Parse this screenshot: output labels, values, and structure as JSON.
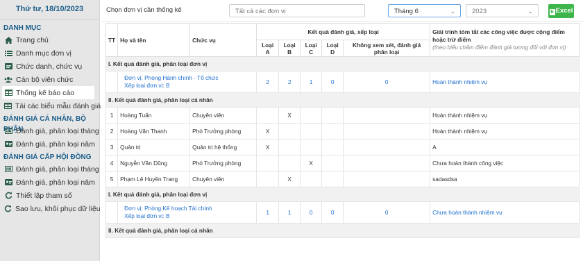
{
  "sidebar": {
    "date": "Thứ tư, 18/10/2023",
    "sections": [
      {
        "title": "DANH MỤC",
        "items": [
          {
            "label": "Trang chủ",
            "icon": "home-icon"
          },
          {
            "label": "Danh mục đơn vị",
            "icon": "list-icon"
          },
          {
            "label": "Chức danh, chức vụ",
            "icon": "card-icon"
          },
          {
            "label": "Cán bộ viên chức",
            "icon": "users-icon"
          },
          {
            "label": "Thống kê báo cáo",
            "icon": "table-icon",
            "active": true
          },
          {
            "label": "Tải các biểu mẫu đánh giá",
            "icon": "table-icon"
          }
        ]
      },
      {
        "title": "ĐÁNH GIÁ CÁ NHÂN, BỘ PHẬN",
        "items": [
          {
            "label": "Đánh giá, phân loại tháng",
            "icon": "form-icon"
          },
          {
            "label": "Đánh giá, phân loại năm",
            "icon": "id-card-icon"
          }
        ]
      },
      {
        "title": "ĐÁNH GIÁ CẤP HỘI ĐỒNG",
        "items": [
          {
            "label": "Đánh giá, phân loại tháng",
            "icon": "form-icon"
          },
          {
            "label": "Đánh giá, phân loại năm",
            "icon": "id-card-icon"
          },
          {
            "label": "Thiết lập tham số",
            "icon": "refresh-icon"
          },
          {
            "label": "Sao lưu, khôi phục dữ liệu",
            "icon": "refresh-icon"
          }
        ]
      }
    ]
  },
  "toolbar": {
    "label": "Chọn đơn vị cần thống kê",
    "unit_value": "Tất cả các đơn vị",
    "month_value": "Tháng 6",
    "year_value": "2023",
    "excel_label": "Excel"
  },
  "table": {
    "headers": {
      "tt": "TT",
      "name": "Họ và tên",
      "position": "Chức vụ",
      "result_group": "Kết quả đánh giá, xếp loại",
      "loai_a": "Loại A",
      "loai_b": "Loại B",
      "loai_c": "Loại C",
      "loai_d": "Loại D",
      "khong_xem_xet": "Không xem xét, đánh giá phân loại",
      "explanation": "Giải trình tóm tắt các công việc được cộng điểm hoặc trừ điểm",
      "explanation_note": "(theo biểu chấm điểm đánh giá tương đối với đơn vị)"
    },
    "sec_unit": "I. Kết quả đánh giá, phân loại đơn vị",
    "sec_person": "II. Kết quả đánh giá, phân loại cá nhân",
    "units": [
      {
        "unit_line": "Đơn vị: Phòng Hành chính - Tổ chức",
        "rank_line": "Xếp loại đơn vị: B",
        "a": "2",
        "b": "2",
        "c": "1",
        "d": "0",
        "none": "0",
        "note": "Hoàn thành nhiệm vụ"
      },
      {
        "unit_line": "Đơn vị: Phòng Kế hoạch Tài chính",
        "rank_line": "Xếp loại đơn vị: B",
        "a": "1",
        "b": "1",
        "c": "0",
        "d": "0",
        "none": "0",
        "note": "Chưa hoàn thành nhiệm vụ"
      }
    ],
    "people": [
      {
        "tt": "1",
        "name": "Hoàng Tuấn",
        "position": "Chuyên viên",
        "a": "",
        "b": "X",
        "c": "",
        "d": "",
        "note": "Hoàn thành nhiệm vụ"
      },
      {
        "tt": "2",
        "name": "Hoàng Văn Thanh",
        "position": "Phó Trưởng phòng",
        "a": "X",
        "b": "",
        "c": "",
        "d": "",
        "note": "Hoàn thành nhiệm vụ"
      },
      {
        "tt": "3",
        "name": "Quản trị",
        "position": "Quản trị hệ thống",
        "a": "X",
        "b": "",
        "c": "",
        "d": "",
        "note": "A"
      },
      {
        "tt": "4",
        "name": "Nguyễn Văn Dũng",
        "position": "Phó Trưởng phòng",
        "a": "",
        "b": "",
        "c": "X",
        "d": "",
        "note": "Chưa hoàn thành công việc"
      },
      {
        "tt": "5",
        "name": "Phạm Lê Huyền Trang",
        "position": "Chuyên viên",
        "a": "",
        "b": "X",
        "c": "",
        "d": "",
        "note": "sadasdsa"
      }
    ]
  }
}
